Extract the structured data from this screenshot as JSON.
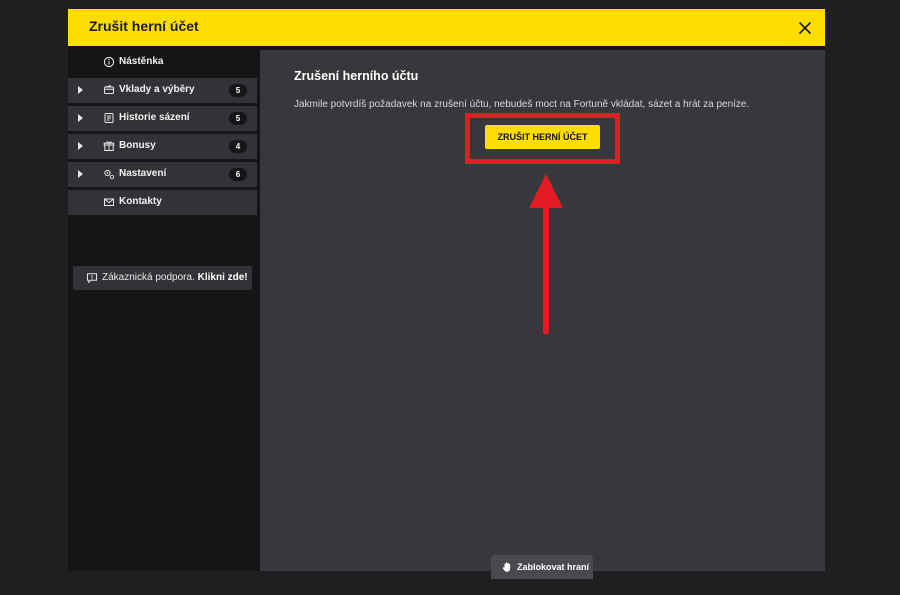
{
  "modal": {
    "title": "Zrušit herní účet",
    "close_icon": "close-icon"
  },
  "sidebar": {
    "items": [
      {
        "label": "Nástěnka",
        "icon": "info-icon",
        "badge": null,
        "expandable": false
      },
      {
        "label": "Vklady a výběry",
        "icon": "wallet-icon",
        "badge": "5",
        "expandable": true
      },
      {
        "label": "Historie sázení",
        "icon": "ticket-icon",
        "badge": "5",
        "expandable": true
      },
      {
        "label": "Bonusy",
        "icon": "gift-icon",
        "badge": "4",
        "expandable": true
      },
      {
        "label": "Nastavení",
        "icon": "settings-icon",
        "badge": "6",
        "expandable": true
      },
      {
        "label": "Kontakty",
        "icon": "envelope-icon",
        "badge": null,
        "expandable": false
      }
    ],
    "support": {
      "text": "Zákaznická podpora.",
      "link": "Klikni zde!",
      "icon": "chat-alert-icon"
    }
  },
  "main": {
    "title": "Zrušení herního účtu",
    "description": "Jakmile potvrdíš požadavek na zrušení účtu, nebudeš moct na Fortuně vkládat, sázet a hrát za peníze.",
    "cancel_button": "ZRUŠIT HERNÍ ÚČET",
    "block_button": "Zablokovat hraní",
    "block_icon": "hand-stop-icon"
  },
  "colors": {
    "accent": "#ffdd00",
    "highlight": "#e31b23",
    "panel": "#38383c",
    "sidebar_item": "#333337"
  }
}
